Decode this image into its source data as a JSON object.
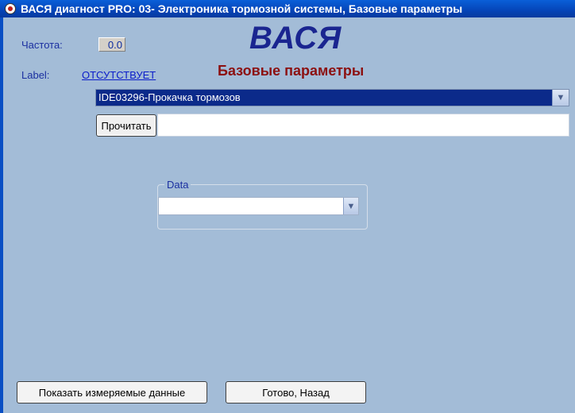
{
  "window": {
    "title": "ВАСЯ диагност PRO: 03- Электроника тормозной системы,  Базовые параметры"
  },
  "header": {
    "frequency_label": "Частота:",
    "frequency_value": "0.0",
    "label_label": "Label:",
    "label_value": "ОТСУТСТВУЕТ",
    "logo": "ВАСЯ",
    "subtitle": "Базовые параметры"
  },
  "main": {
    "function_select": {
      "value": "IDE03296-Прокачка тормозов"
    },
    "read_button": "Прочитать",
    "result_value": "",
    "data_group": {
      "legend": "Data",
      "select_value": ""
    }
  },
  "footer": {
    "show_measured_button": "Показать измеряемые данные",
    "done_back_button": "Готово, Назад"
  }
}
